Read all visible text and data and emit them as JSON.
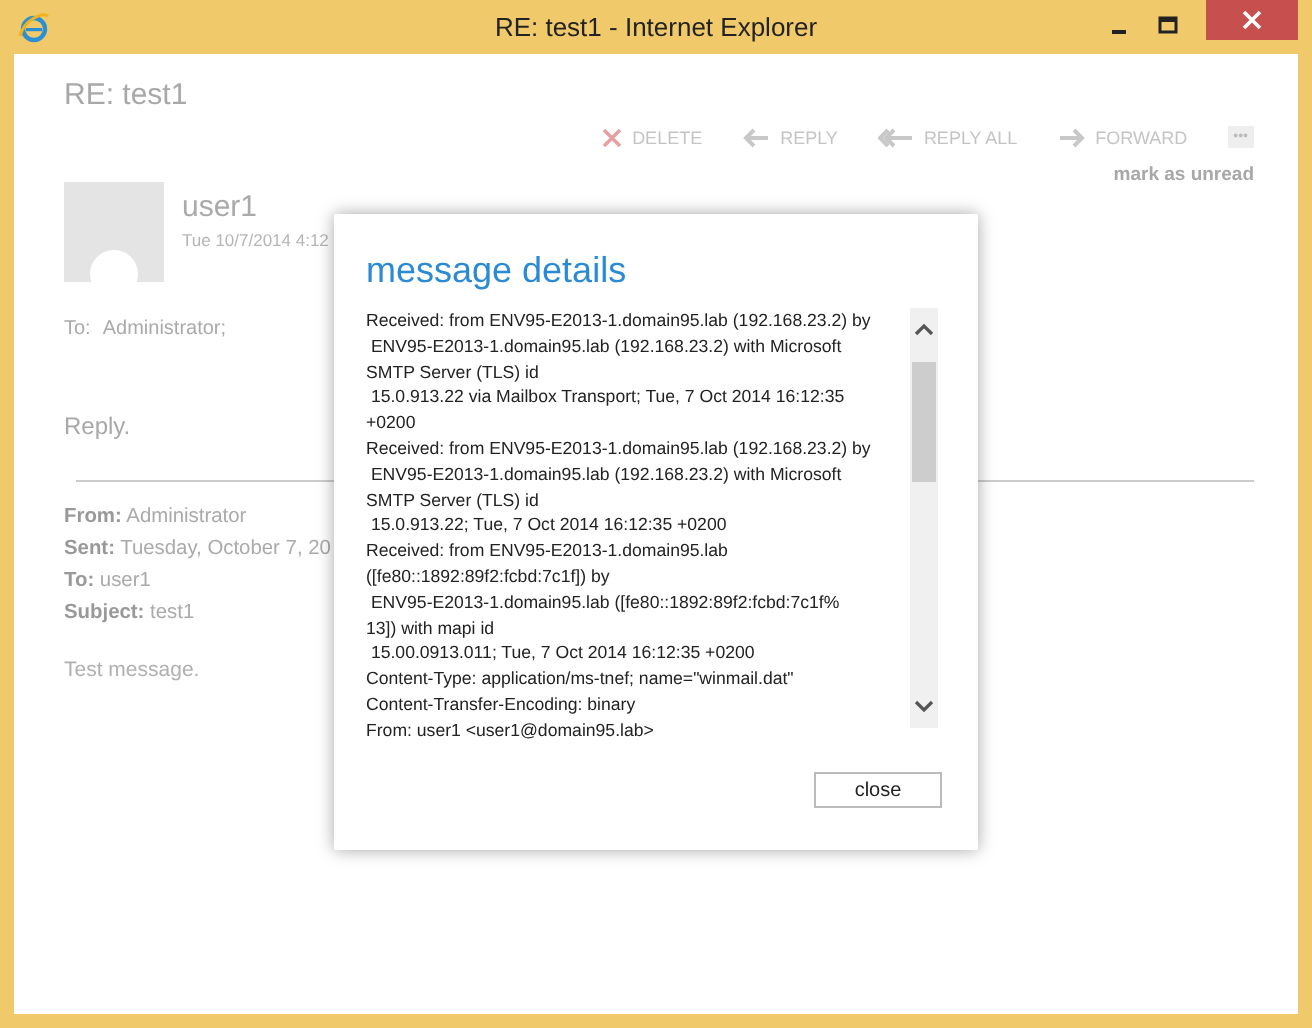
{
  "window": {
    "title": "RE: test1 - Internet Explorer"
  },
  "message": {
    "subject": "RE: test1",
    "toolbar": [
      {
        "kind": "delete",
        "label": "DELETE"
      },
      {
        "kind": "reply",
        "label": "REPLY"
      },
      {
        "kind": "reply_all",
        "label": "REPLY ALL"
      },
      {
        "kind": "forward",
        "label": "FORWARD"
      },
      {
        "kind": "more",
        "label": "•••"
      }
    ],
    "mark_unread": "mark as unread",
    "sender": "user1",
    "date": "Tue 10/7/2014 4:12",
    "to_label": "To:",
    "to": "Administrator;",
    "body": "Reply.",
    "quoted": [
      {
        "label": "From:",
        "value": "Administrator"
      },
      {
        "label": "Sent:",
        "value": "Tuesday, October 7, 20"
      },
      {
        "label": "To:",
        "value": "user1"
      },
      {
        "label": "Subject:",
        "value": "test1"
      }
    ],
    "quoted_body": "Test message."
  },
  "dialog": {
    "title": "message details",
    "headers": "Received: from ENV95-E2013-1.domain95.lab (192.168.23.2) by\n ENV95-E2013-1.domain95.lab (192.168.23.2) with Microsoft\nSMTP Server (TLS) id\n 15.0.913.22 via Mailbox Transport; Tue, 7 Oct 2014 16:12:35\n+0200\nReceived: from ENV95-E2013-1.domain95.lab (192.168.23.2) by\n ENV95-E2013-1.domain95.lab (192.168.23.2) with Microsoft\nSMTP Server (TLS) id\n 15.0.913.22; Tue, 7 Oct 2014 16:12:35 +0200\nReceived: from ENV95-E2013-1.domain95.lab\n([fe80::1892:89f2:fcbd:7c1f]) by\n ENV95-E2013-1.domain95.lab ([fe80::1892:89f2:fcbd:7c1f%\n13]) with mapi id\n 15.00.0913.011; Tue, 7 Oct 2014 16:12:35 +0200\nContent-Type: application/ms-tnef; name=\"winmail.dat\"\nContent-Transfer-Encoding: binary\nFrom: user1 <user1@domain95.lab>",
    "close": "close"
  }
}
